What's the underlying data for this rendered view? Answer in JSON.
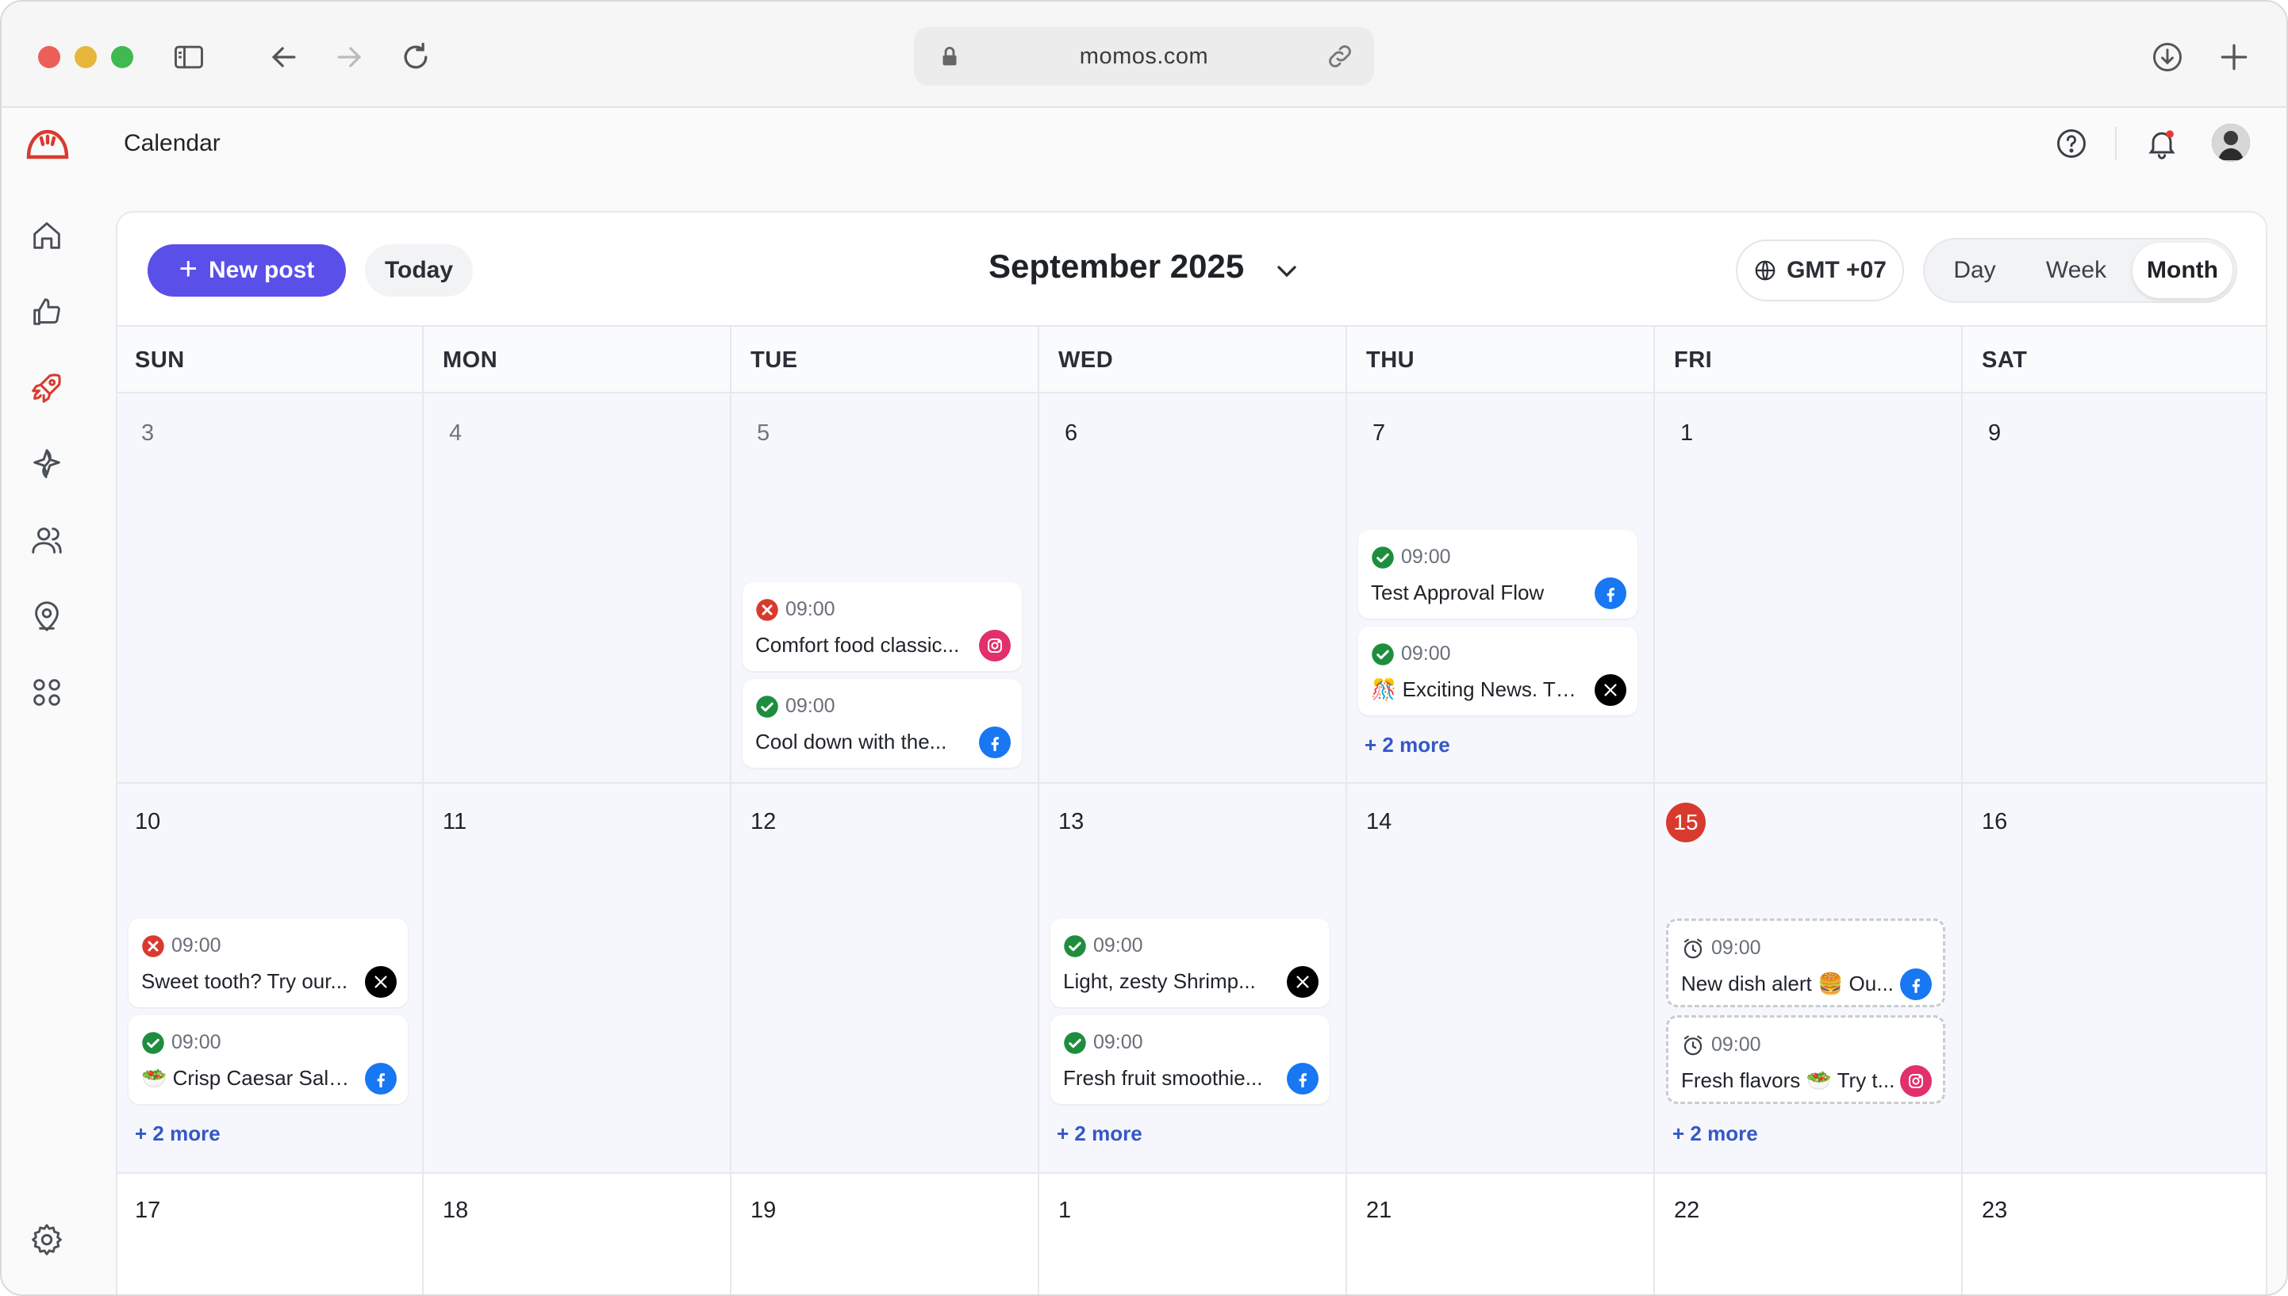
{
  "browser": {
    "url": "momos.com"
  },
  "app": {
    "page_title": "Calendar"
  },
  "sidebar": {
    "items": [
      {
        "name": "home",
        "icon": "home-icon"
      },
      {
        "name": "reviews",
        "icon": "thumbs-up-icon"
      },
      {
        "name": "publish",
        "icon": "rocket-icon",
        "active": true
      },
      {
        "name": "ai",
        "icon": "sparkle-icon"
      },
      {
        "name": "people",
        "icon": "users-icon"
      },
      {
        "name": "locations",
        "icon": "location-pin-icon"
      },
      {
        "name": "apps",
        "icon": "grid-icon"
      },
      {
        "name": "settings",
        "icon": "gear-icon"
      }
    ]
  },
  "toolbar": {
    "new_post": "New post",
    "today": "Today",
    "month_label": "September 2025",
    "timezone": "GMT +07",
    "views": [
      "Day",
      "Week",
      "Month"
    ],
    "active_view": "Month"
  },
  "colors": {
    "accent": "#5b4fe9",
    "today": "#d93a2f",
    "success": "#1e8e3e",
    "error": "#d93a2f",
    "facebook": "#1877f2",
    "instagram": "#e1306c",
    "x": "#000000",
    "more_link": "#3558c4"
  },
  "calendar": {
    "weekdays": [
      "SUN",
      "MON",
      "TUE",
      "WED",
      "THU",
      "FRI",
      "SAT"
    ],
    "weeks": [
      {
        "days": [
          "3",
          "4",
          "5",
          "6",
          "7",
          "1",
          "9"
        ],
        "muted": [
          true,
          true,
          true,
          false,
          false,
          false,
          false
        ]
      },
      {
        "days": [
          "10",
          "11",
          "12",
          "13",
          "14",
          "15",
          "16"
        ],
        "today_index": 5
      },
      {
        "days": [
          "17",
          "18",
          "19",
          "1",
          "21",
          "22",
          "23"
        ]
      }
    ],
    "posts": {
      "tue_5": [
        {
          "status": "failed",
          "time": "09:00",
          "title": "Comfort food classic...",
          "network": "instagram"
        },
        {
          "status": "published",
          "time": "09:00",
          "title": "Cool down with the...",
          "network": "facebook"
        }
      ],
      "thu_7": [
        {
          "status": "published",
          "time": "09:00",
          "title": "Test Approval Flow",
          "network": "facebook"
        },
        {
          "status": "published",
          "time": "09:00",
          "title": "🎊 Exciting News. Thi...",
          "network": "x"
        }
      ],
      "sun_10": [
        {
          "status": "failed",
          "time": "09:00",
          "title": "Sweet tooth? Try our...",
          "network": "x"
        },
        {
          "status": "published",
          "time": "09:00",
          "title": "🥗 Crisp Caesar Sala...",
          "network": "facebook"
        }
      ],
      "wed_13": [
        {
          "status": "published",
          "time": "09:00",
          "title": "Light, zesty Shrimp...",
          "network": "x"
        },
        {
          "status": "published",
          "time": "09:00",
          "title": "Fresh fruit smoothie...",
          "network": "facebook"
        }
      ],
      "fri_15": [
        {
          "status": "scheduled",
          "time": "09:00",
          "title": "New dish alert 🍔 Ou...",
          "network": "facebook"
        },
        {
          "status": "scheduled",
          "time": "09:00",
          "title": "Fresh flavors 🥗 Try t...",
          "network": "instagram"
        }
      ]
    },
    "more_links": {
      "thu_7": "+ 2 more",
      "sun_10": "+ 2 more",
      "wed_13": "+ 2 more",
      "fri_15": "+ 2 more"
    }
  }
}
